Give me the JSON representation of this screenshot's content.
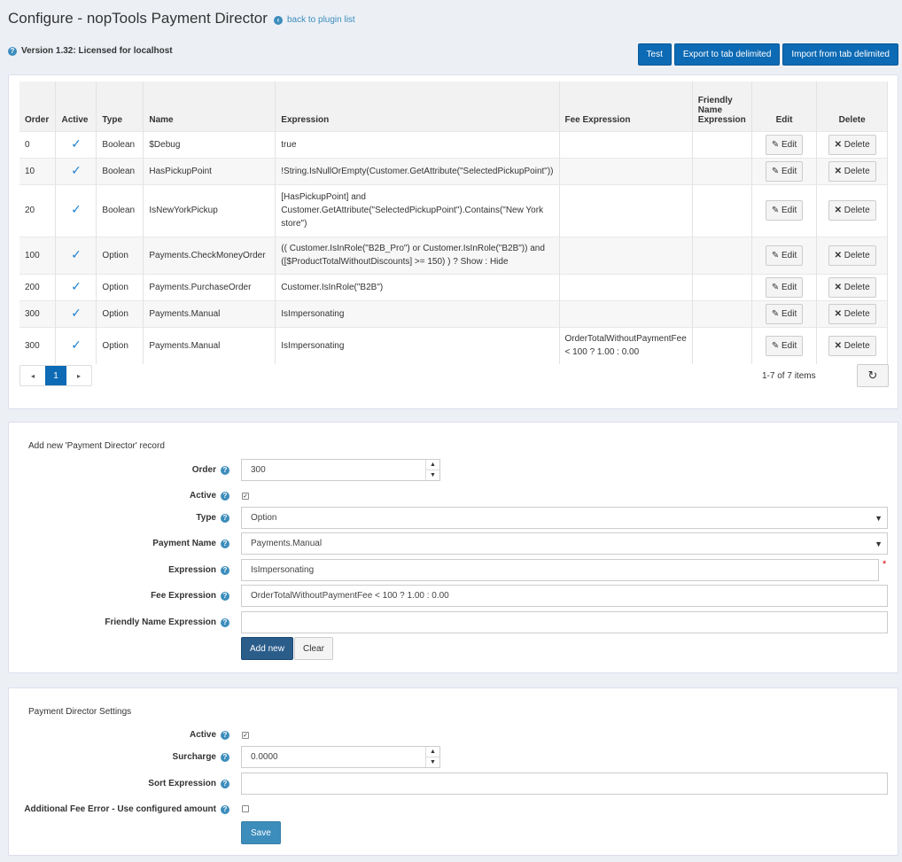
{
  "header": {
    "title": "Configure - nopTools Payment Director",
    "back_link": "back to plugin list",
    "version": "Version 1.32: Licensed for localhost"
  },
  "toolbar": {
    "test": "Test",
    "export": "Export to tab delimited",
    "import": "Import from tab delimited"
  },
  "grid": {
    "columns": [
      "Order",
      "Active",
      "Type",
      "Name",
      "Expression",
      "Fee Expression",
      "Friendly Name Expression",
      "Edit",
      "Delete"
    ],
    "edit_label": "Edit",
    "delete_label": "Delete",
    "rows": [
      {
        "order": "0",
        "active": true,
        "type": "Boolean",
        "name": "$Debug",
        "expression": "true",
        "fee": "",
        "friendly": ""
      },
      {
        "order": "10",
        "active": true,
        "type": "Boolean",
        "name": "HasPickupPoint",
        "expression": "!String.IsNullOrEmpty(Customer.GetAttribute(\"SelectedPickupPoint\"))",
        "fee": "",
        "friendly": ""
      },
      {
        "order": "20",
        "active": true,
        "type": "Boolean",
        "name": "IsNewYorkPickup",
        "expression": "[HasPickupPoint] and Customer.GetAttribute(\"SelectedPickupPoint\").Contains(\"New York store\")",
        "fee": "",
        "friendly": ""
      },
      {
        "order": "100",
        "active": true,
        "type": "Option",
        "name": "Payments.CheckMoneyOrder",
        "expression": "(( Customer.IsInRole(\"B2B_Pro\") or Customer.IsInRole(\"B2B\")) and ([$ProductTotalWithoutDiscounts] >= 150) ) ? Show : Hide",
        "fee": "",
        "friendly": ""
      },
      {
        "order": "200",
        "active": true,
        "type": "Option",
        "name": "Payments.PurchaseOrder",
        "expression": "Customer.IsInRole(\"B2B\")",
        "fee": "",
        "friendly": ""
      },
      {
        "order": "300",
        "active": true,
        "type": "Option",
        "name": "Payments.Manual",
        "expression": "IsImpersonating",
        "fee": "",
        "friendly": ""
      },
      {
        "order": "300",
        "active": true,
        "type": "Option",
        "name": "Payments.Manual",
        "expression": "IsImpersonating",
        "fee": "OrderTotalWithoutPaymentFee < 100 ? 1.00 : 0.00",
        "friendly": ""
      }
    ],
    "pager": {
      "prev": "◂",
      "page": "1",
      "next": "▸"
    },
    "items_count": "1-7 of 7 items"
  },
  "add_form": {
    "title": "Add new 'Payment Director' record",
    "order_label": "Order",
    "order_value": "300",
    "active_label": "Active",
    "active_checked": true,
    "type_label": "Type",
    "type_value": "Option",
    "payment_name_label": "Payment Name",
    "payment_name_value": "Payments.Manual",
    "expression_label": "Expression",
    "expression_value": "IsImpersonating",
    "required_marker": "*",
    "fee_label": "Fee Expression",
    "fee_value": "OrderTotalWithoutPaymentFee < 100 ? 1.00 : 0.00",
    "friendly_label": "Friendly Name Expression",
    "friendly_value": "",
    "add_button": "Add new",
    "clear_button": "Clear"
  },
  "settings": {
    "title": "Payment Director Settings",
    "active_label": "Active",
    "active_checked": true,
    "surcharge_label": "Surcharge",
    "surcharge_value": "0.0000",
    "sort_label": "Sort Expression",
    "sort_value": "",
    "fee_error_label": "Additional Fee Error - Use configured amount",
    "fee_error_checked": false,
    "save_button": "Save"
  },
  "colors": {
    "primary": "#0d6ab4",
    "check": "#1a7fd0",
    "add_button": "#2b5d8b",
    "save_button": "#3c8dbc"
  }
}
